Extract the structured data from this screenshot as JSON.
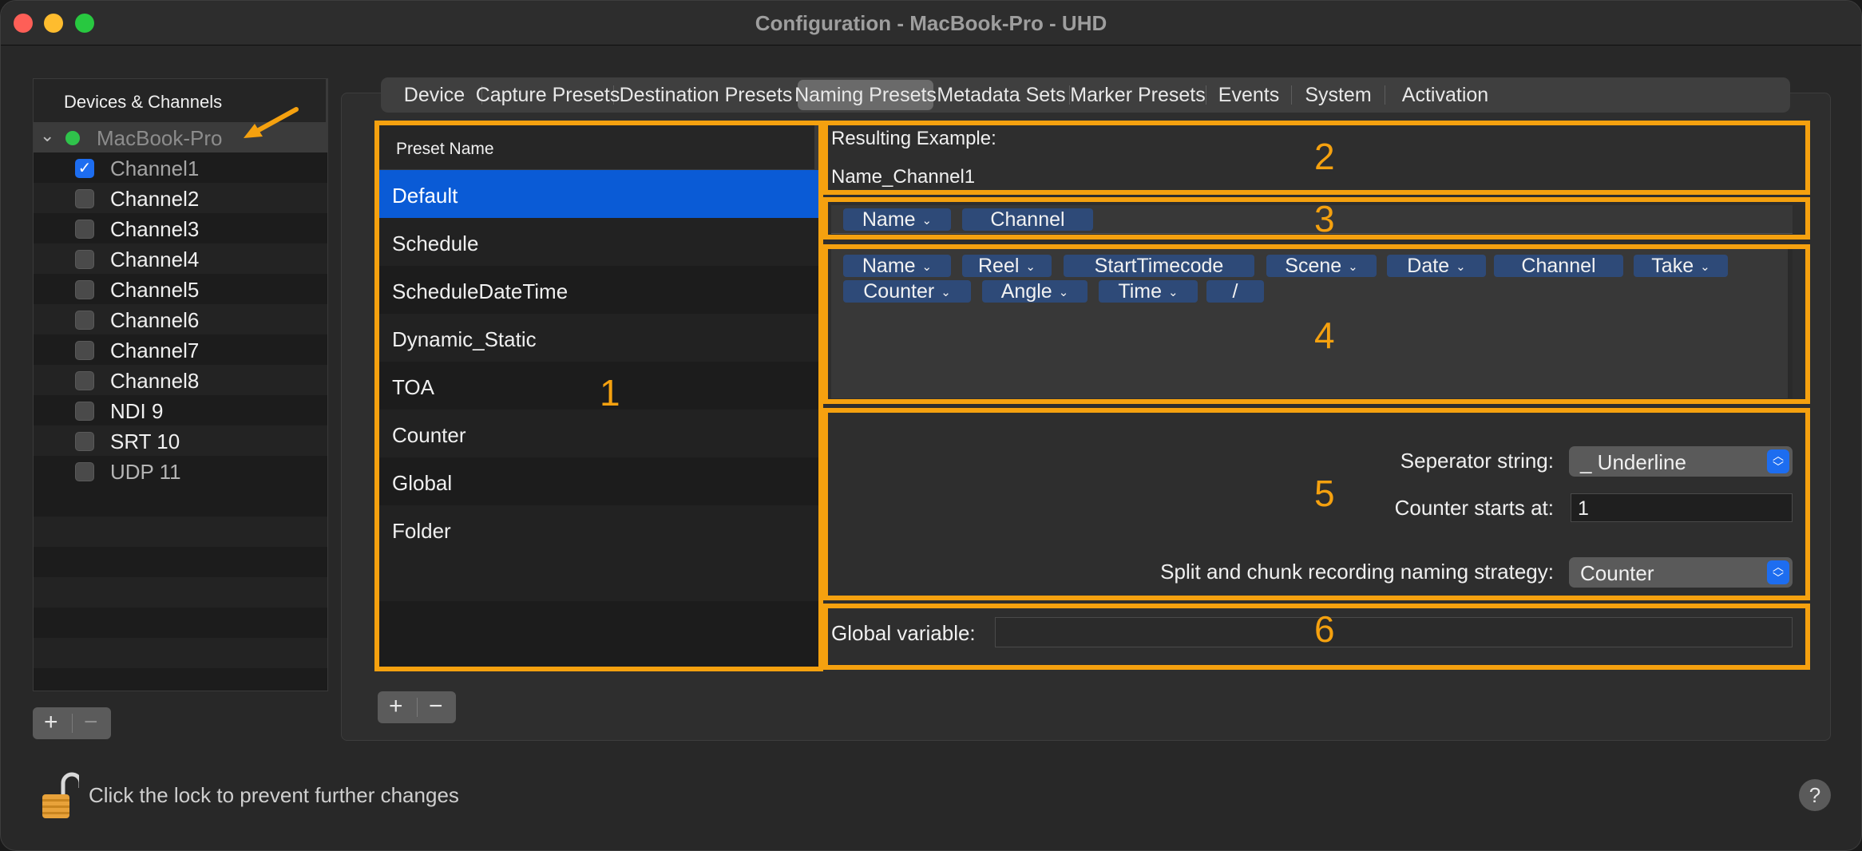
{
  "window": {
    "title": "Configuration - MacBook-Pro - UHD"
  },
  "sidebar": {
    "header": "Devices & Channels",
    "device": {
      "name": "MacBook-Pro",
      "status_color": "#2fc34b"
    },
    "channels": [
      {
        "label": "Channel1",
        "checked": true
      },
      {
        "label": "Channel2",
        "checked": false
      },
      {
        "label": "Channel3",
        "checked": false
      },
      {
        "label": "Channel4",
        "checked": false
      },
      {
        "label": "Channel5",
        "checked": false
      },
      {
        "label": "Channel6",
        "checked": false
      },
      {
        "label": "Channel7",
        "checked": false
      },
      {
        "label": "Channel8",
        "checked": false
      },
      {
        "label": "NDI 9",
        "checked": false
      },
      {
        "label": "SRT 10",
        "checked": false
      },
      {
        "label": "UDP 11",
        "checked": false
      }
    ],
    "add_label": "+",
    "remove_label": "−"
  },
  "tabs": [
    {
      "label": "Device"
    },
    {
      "label": "Capture Presets"
    },
    {
      "label": "Destination Presets"
    },
    {
      "label": "Naming Presets",
      "active": true
    },
    {
      "label": "Metadata Sets"
    },
    {
      "label": "Marker Presets"
    },
    {
      "label": "Events"
    },
    {
      "label": "System"
    },
    {
      "label": "Activation"
    }
  ],
  "presets": {
    "header": "Preset Name",
    "items": [
      "Default",
      "Schedule",
      "ScheduleDateTime",
      "Dynamic_Static",
      "TOA",
      "Counter",
      "Global",
      "Folder"
    ],
    "selected": "Default",
    "add_label": "+",
    "remove_label": "−"
  },
  "result": {
    "label": "Resulting Example:",
    "value": "Name_Channel1"
  },
  "active_tokens": [
    {
      "label": "Name",
      "dropdown": true
    },
    {
      "label": "Channel",
      "dropdown": false
    }
  ],
  "available_tokens": [
    {
      "label": "Name",
      "dropdown": true
    },
    {
      "label": "Reel",
      "dropdown": true
    },
    {
      "label": "StartTimecode",
      "dropdown": false
    },
    {
      "label": "Scene",
      "dropdown": true
    },
    {
      "label": "Date",
      "dropdown": true
    },
    {
      "label": "Channel",
      "dropdown": false
    },
    {
      "label": "Take",
      "dropdown": true
    },
    {
      "label": "Counter",
      "dropdown": true
    },
    {
      "label": "Angle",
      "dropdown": true
    },
    {
      "label": "Time",
      "dropdown": true
    },
    {
      "label": "/",
      "dropdown": false
    }
  ],
  "settings": {
    "separator_label": "Seperator string:",
    "separator_value": "_ Underline",
    "counter_label": "Counter starts at:",
    "counter_value": "1",
    "split_label": "Split and chunk recording naming strategy:",
    "split_value": "Counter"
  },
  "global": {
    "label": "Global variable:",
    "value": ""
  },
  "annotations": [
    "1",
    "2",
    "3",
    "4",
    "5",
    "6"
  ],
  "annotation_color": "#f5a10f",
  "accent_color": "#0a5bd6",
  "footer": {
    "lock_text": "Click the lock to prevent further changes",
    "help_label": "?"
  }
}
